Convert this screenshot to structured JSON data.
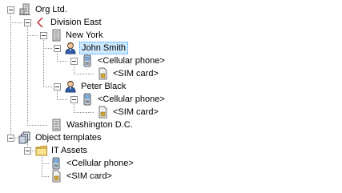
{
  "tree": {
    "org": "Org Ltd.",
    "division_east": "Division East",
    "new_york": "New York",
    "john_smith": "John Smith",
    "john_phone": "<Cellular phone>",
    "john_sim": "<SIM card>",
    "peter_black": "Peter Black",
    "peter_phone": "<Cellular phone>",
    "peter_sim": "<SIM card>",
    "washington": "Washington D.C.",
    "object_templates": "Object templates",
    "it_assets": "IT Assets",
    "template_phone": "<Cellular phone>",
    "template_sim": "<SIM card>"
  },
  "colors": {
    "selection_bg": "#cce8ff",
    "selection_border": "#3399ff",
    "folder_yellow": "#f6d46a",
    "division_red": "#c0282d"
  }
}
